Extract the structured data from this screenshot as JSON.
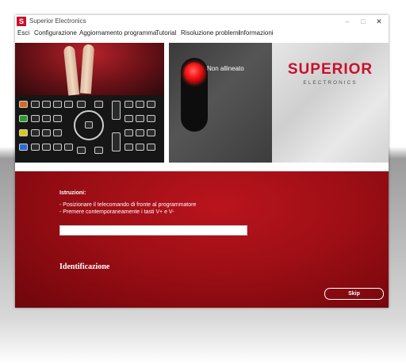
{
  "window": {
    "app_icon": "S",
    "title": "Superior Electronics",
    "minimize_icon": "minimize-icon",
    "maximize_icon": "maximize-icon",
    "close_icon": "close-icon",
    "close_symbol": "✕"
  },
  "menu": [
    "Esci",
    "Configurazione",
    "Aggiornamento programma",
    "Tutorial",
    "Risoluzione problemi",
    "Informazioni"
  ],
  "signal": {
    "status": "Non allineato"
  },
  "brand": {
    "name": "SUPERIOR",
    "sub": "ELECTRONICS"
  },
  "instructions": {
    "title": "Istruzioni:",
    "lines": [
      "- Posizionare il telecomando di fronte al programmatore",
      "- Premere contemporaneamente i tasti V+ e V-"
    ]
  },
  "progress": {
    "value": 0
  },
  "identification": {
    "label": "Identificazione"
  },
  "buttons": {
    "skip": "Skip"
  },
  "colors": {
    "accent": "#c8102e",
    "led": "#ff1e1e"
  }
}
